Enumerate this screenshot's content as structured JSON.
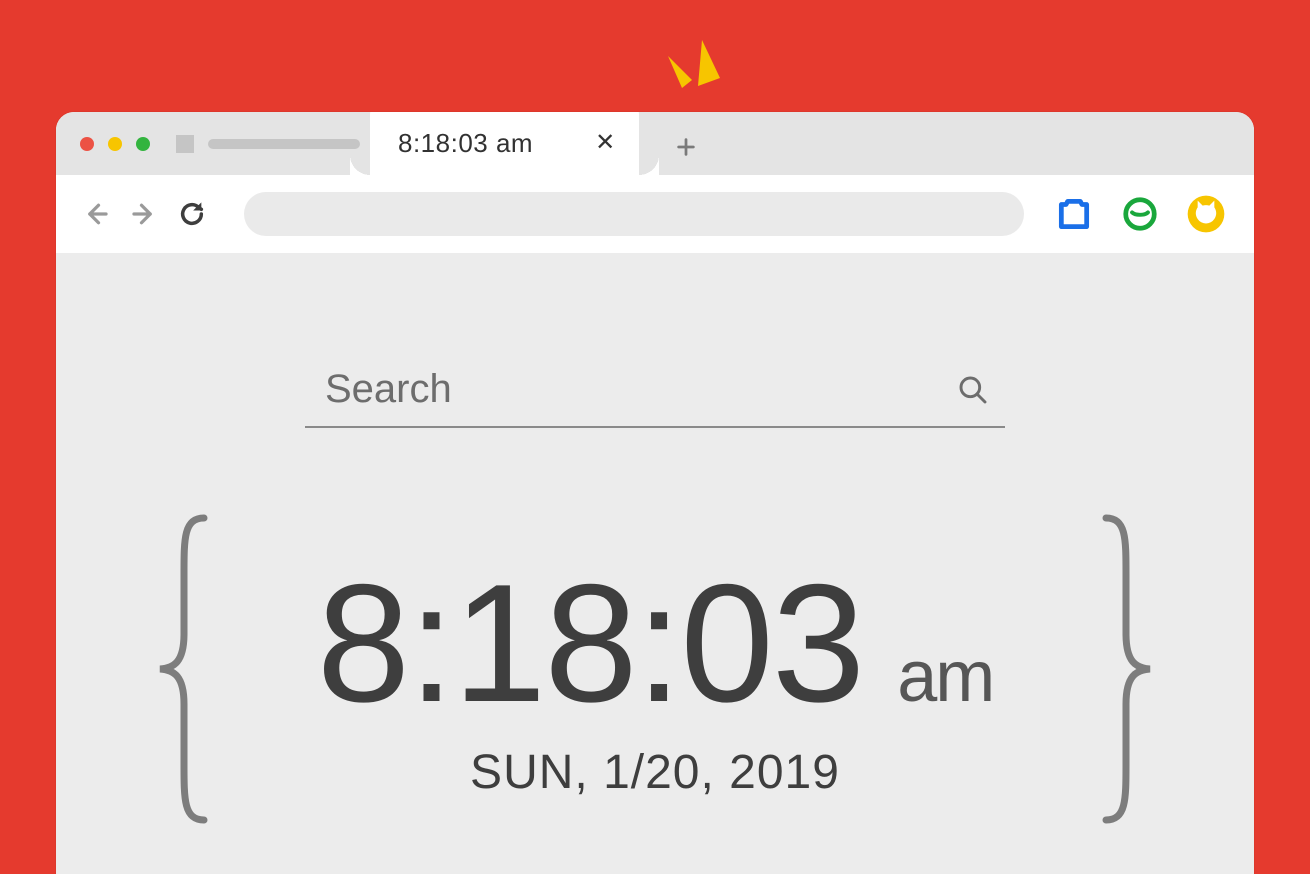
{
  "tab": {
    "title": "8:18:03 am",
    "close_glyph": "✕"
  },
  "toolbar": {
    "back_name": "back",
    "forward_name": "forward",
    "reload_name": "reload"
  },
  "extensions": {
    "ext1_name": "screenshot-icon",
    "ext2_name": "clock-icon",
    "ext3_name": "cat-icon"
  },
  "search": {
    "placeholder": "Search"
  },
  "clock": {
    "time": "8:18:03",
    "ampm": "am",
    "date": "SUN, 1/20, 2019"
  }
}
